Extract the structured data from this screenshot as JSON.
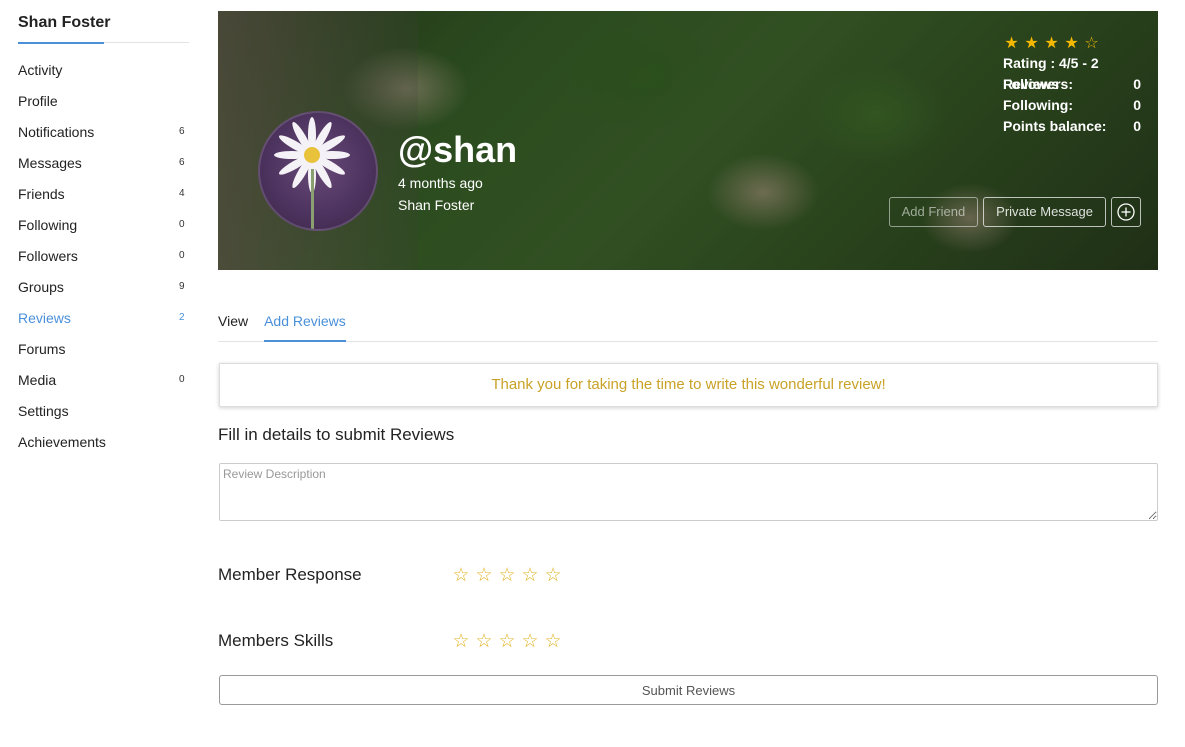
{
  "sidebar": {
    "user_name": "Shan Foster",
    "items": [
      {
        "label": "Activity",
        "count": ""
      },
      {
        "label": "Profile",
        "count": ""
      },
      {
        "label": "Notifications",
        "count": "6"
      },
      {
        "label": "Messages",
        "count": "6"
      },
      {
        "label": "Friends",
        "count": "4"
      },
      {
        "label": "Following",
        "count": "0"
      },
      {
        "label": "Followers",
        "count": "0"
      },
      {
        "label": "Groups",
        "count": "9"
      },
      {
        "label": "Reviews",
        "count": "2"
      },
      {
        "label": "Forums",
        "count": ""
      },
      {
        "label": "Media",
        "count": "0"
      },
      {
        "label": "Settings",
        "count": ""
      },
      {
        "label": "Achievements",
        "count": ""
      }
    ],
    "active_item": "Reviews"
  },
  "profile": {
    "handle": "@shan",
    "time_ago": "4 months ago",
    "display_name": "Shan Foster",
    "rating_stars": 4,
    "rating_max": 5,
    "rating_text": "Rating : 4/5 - 2 Reviews",
    "followers_label": "Followers:",
    "followers_value": "0",
    "following_label": "Following:",
    "following_value": "0",
    "points_label": "Points balance:",
    "points_value": "0",
    "add_friend_label": "Add Friend",
    "private_message_label": "Private Message"
  },
  "tabs": [
    {
      "label": "View"
    },
    {
      "label": "Add Reviews"
    }
  ],
  "active_tab": "Add Reviews",
  "notice": "Thank you for taking the time to write this wonderful review!",
  "form": {
    "title": "Fill in details to submit Reviews",
    "description_placeholder": "Review Description",
    "description_value": "",
    "criteria": [
      {
        "label": "Member Response",
        "rating": 0,
        "max": 5
      },
      {
        "label": "Members Skills",
        "rating": 0,
        "max": 5
      }
    ],
    "submit_label": "Submit Reviews"
  },
  "colors": {
    "accent": "#4a90d9",
    "star": "#f5b800",
    "notice_text": "#c9a227"
  }
}
